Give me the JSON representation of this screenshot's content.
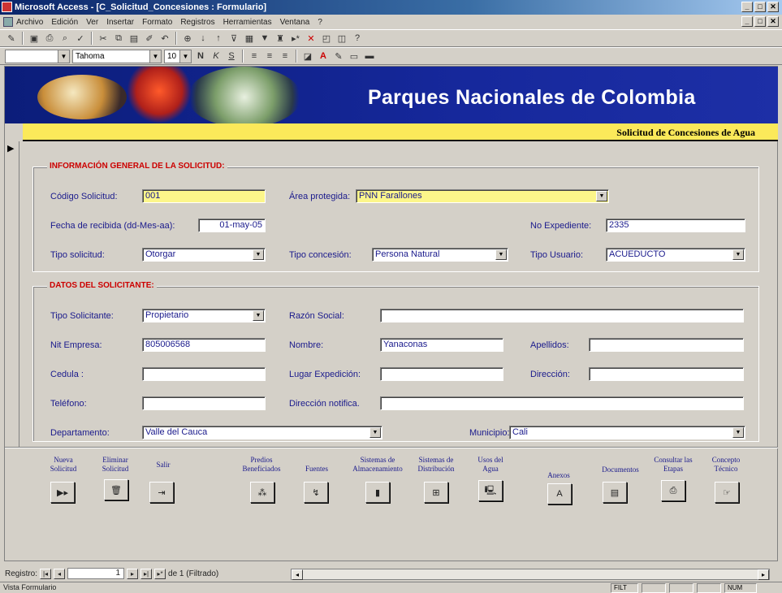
{
  "window": {
    "title": "Microsoft Access - [C_Solicitud_Concesiones : Formulario]",
    "controls": [
      "_",
      "□",
      "✕"
    ]
  },
  "menu": [
    "Archivo",
    "Edición",
    "Ver",
    "Insertar",
    "Formato",
    "Registros",
    "Herramientas",
    "Ventana",
    "?"
  ],
  "format_toolbar": {
    "font": "Tahoma",
    "size": "10"
  },
  "banner": {
    "title": "Parques Nacionales de Colombia",
    "subtitle": "Solicitud de Concesiones de Agua"
  },
  "record_selector": "▶",
  "general": {
    "section_title": "INFORMACIÓN GENERAL DE LA SOLICITUD:",
    "codigo_label": "Código Solicitud:",
    "codigo_value": "001",
    "area_label": "Área protegida:",
    "area_value": "PNN Farallones",
    "fecha_label": "Fecha de recibida (dd-Mes-aa):",
    "fecha_value": "01-may-05",
    "expediente_label": "No Expediente:",
    "expediente_value": "2335",
    "tipo_solicitud_label": "Tipo solicitud:",
    "tipo_solicitud_value": "Otorgar",
    "tipo_concesion_label": "Tipo concesión:",
    "tipo_concesion_value": "Persona Natural",
    "tipo_usuario_label": "Tipo Usuario:",
    "tipo_usuario_value": "ACUEDUCTO"
  },
  "solicitante": {
    "section_title": "DATOS DEL SOLICITANTE:",
    "tipo_label": "Tipo Solicitante:",
    "tipo_value": "Propietario",
    "razon_label": "Razón Social:",
    "razon_value": "",
    "nit_label": "Nit Empresa:",
    "nit_value": "805006568",
    "nombre_label": "Nombre:",
    "nombre_value": "Yanaconas",
    "apellidos_label": "Apellidos:",
    "apellidos_value": "",
    "cedula_label": "Cedula :",
    "cedula_value": "",
    "lugar_label": "Lugar Expedición:",
    "lugar_value": "",
    "direccion_label": "Dirección:",
    "direccion_value": "",
    "telefono_label": "Teléfono:",
    "telefono_value": "",
    "dir_notif_label": "Dirección notifica.",
    "dir_notif_value": "",
    "departamento_label": "Departamento:",
    "departamento_value": "Valle del Cauca",
    "municipio_label": "Municipio:",
    "municipio_value": "Cali"
  },
  "buttons": [
    {
      "label": "Nueva Solicitud",
      "icon": "▶▸"
    },
    {
      "label": "Eliminar Solicitud",
      "icon": "🗑"
    },
    {
      "label": "Salir",
      "icon": "⇥"
    },
    {
      "label": "Predios Beneficiados",
      "icon": "⁂"
    },
    {
      "label": "Fuentes",
      "icon": "↯"
    },
    {
      "label": "Sistemas de Almacenamiento",
      "icon": "▮"
    },
    {
      "label": "Sistemas de Distribución",
      "icon": "⊞"
    },
    {
      "label": "Usos del Agua",
      "icon": "🖳"
    },
    {
      "label": "Anexos",
      "icon": "A"
    },
    {
      "label": "Documentos",
      "icon": "▤"
    },
    {
      "label": "Consultar las Etapas",
      "icon": "⎙"
    },
    {
      "label": "Concepto Técnico",
      "icon": "☞"
    }
  ],
  "navigation": {
    "label": "Registro:",
    "current": "1",
    "total_text": "de 1 (Filtrado)"
  },
  "status": {
    "text": "Vista Formulario",
    "mode": "FILT",
    "num": "NUM"
  }
}
